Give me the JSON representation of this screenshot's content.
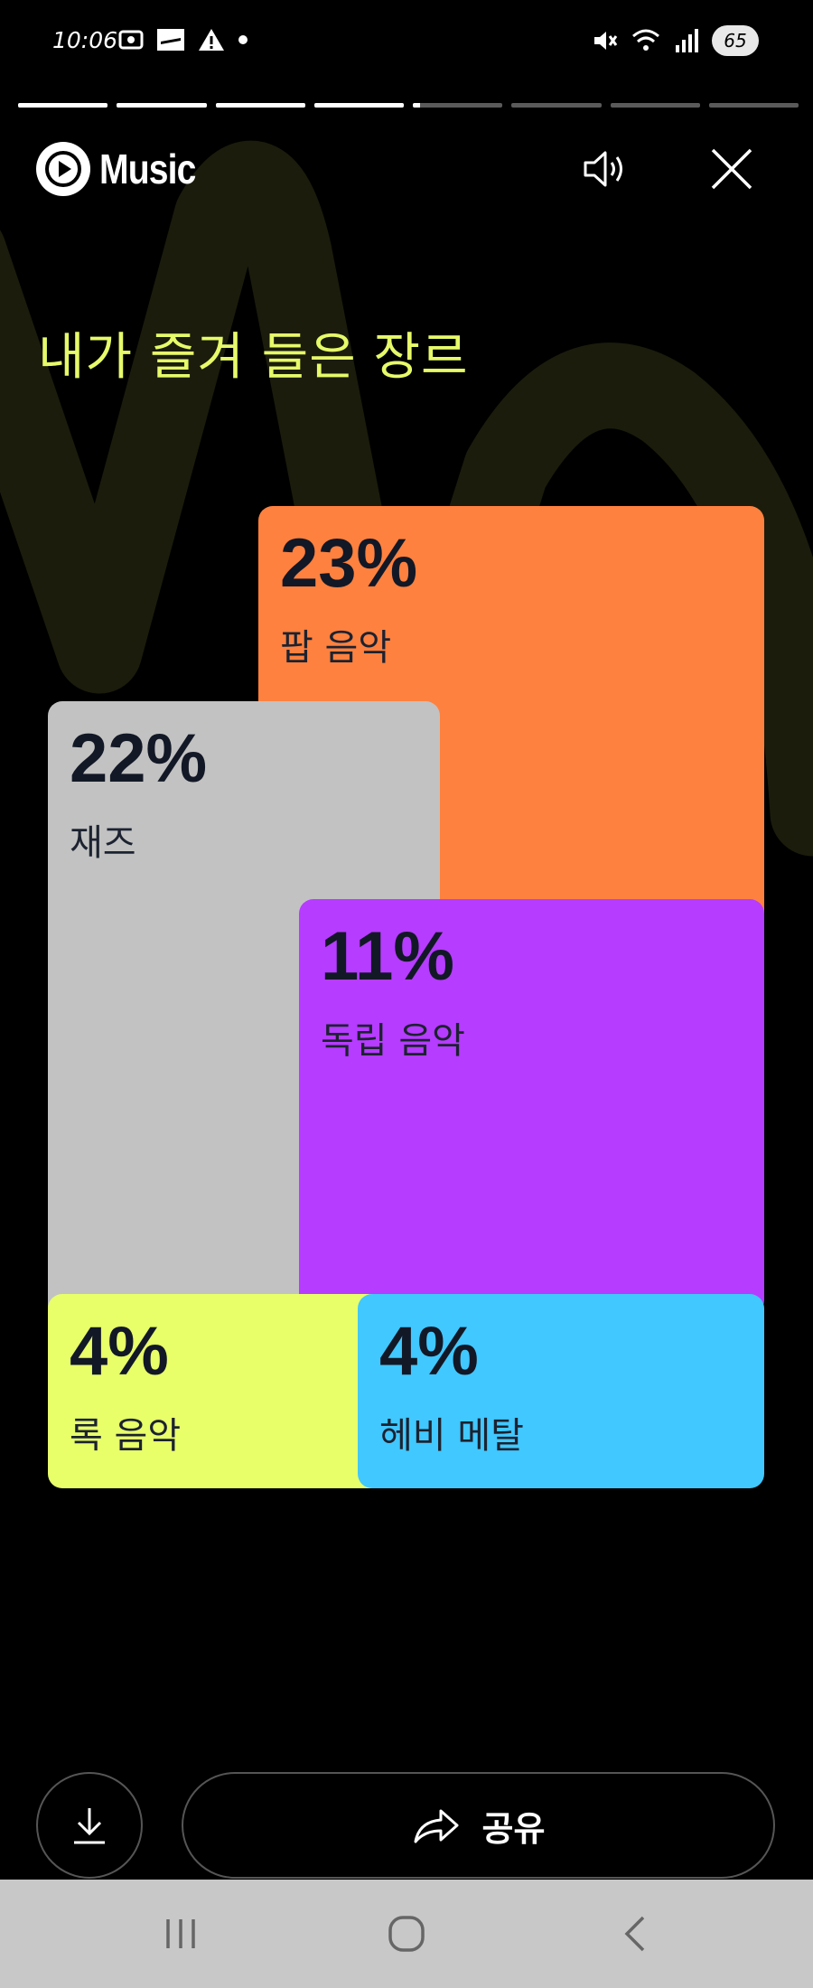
{
  "status_bar": {
    "time": "10:06",
    "battery": "65"
  },
  "story_progress": {
    "segments": [
      1,
      1,
      1,
      1,
      0.08,
      0,
      0,
      0
    ]
  },
  "header": {
    "app_name": "Music"
  },
  "title": "내가 즐겨 들은 장르",
  "genres": [
    {
      "percent": "23%",
      "name": "팝 음악",
      "color": "#ff813f"
    },
    {
      "percent": "22%",
      "name": "재즈",
      "color": "#c2c2c2"
    },
    {
      "percent": "11%",
      "name": "독립 음악",
      "color": "#b63cff"
    },
    {
      "percent": "4%",
      "name": "록 음악",
      "color": "#e8ff6a"
    },
    {
      "percent": "4%",
      "name": "헤비 메탈",
      "color": "#41c8ff"
    }
  ],
  "actions": {
    "share_label": "공유"
  },
  "icons": [
    "download-icon",
    "share-arrow-icon",
    "speaker-icon",
    "close-icon",
    "play-icon",
    "recents-icon",
    "home-icon",
    "back-icon"
  ]
}
